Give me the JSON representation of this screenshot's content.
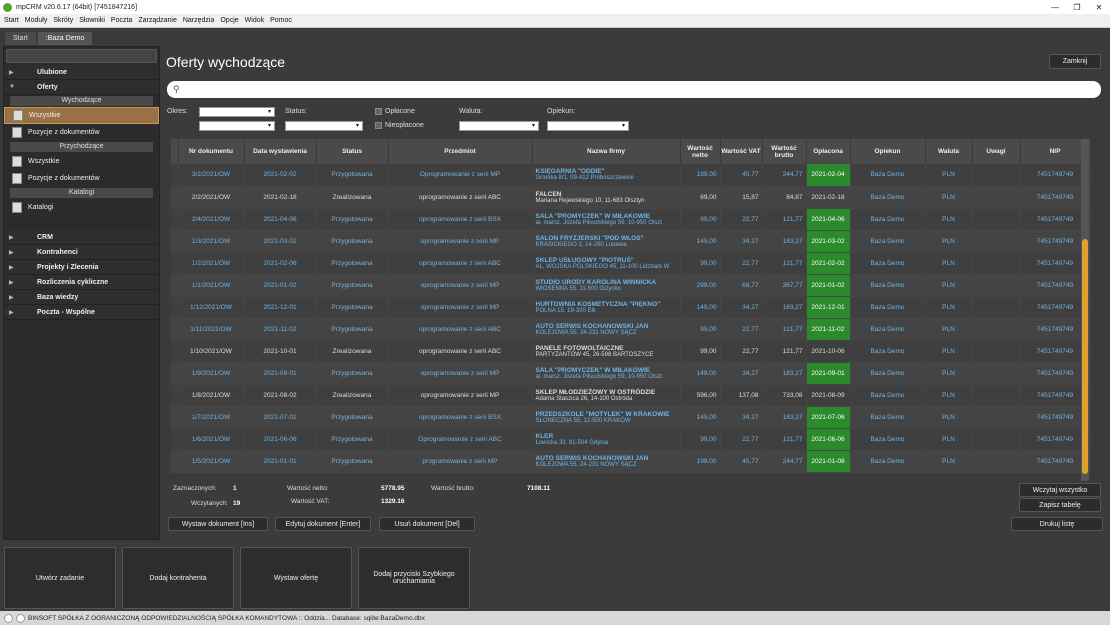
{
  "window": {
    "title": "mpCRM v20.6.17 (64bit) [7451847216]"
  },
  "menu": [
    "Start",
    "Moduły",
    "Skróty",
    "Słowniki",
    "Poczta",
    "Zarządzanie",
    "Narzędzia",
    "Opcje",
    "Widok",
    "Pomoc"
  ],
  "tabs": [
    "Start",
    ":Baza Demo"
  ],
  "sidebar": {
    "ulubione": "Ulubione",
    "oferty": "Oferty",
    "wychodzace": "Wychodzące",
    "wszystkie": "Wszystkie",
    "pozycje": "Pozycje z dokumentów",
    "przychodzace": "Przychodzące",
    "wszystkie2": "Wszystkie",
    "pozycje2": "Pozycje z dokumentów",
    "katalogi_hdr": "Katalogi",
    "katalogi": "Katalogi",
    "crm": "CRM",
    "kontrahenci": "Kontrahenci",
    "projekty": "Projekty i Zlecenia",
    "rozliczenia": "Rozliczenia cykliczne",
    "baza": "Baza wiedzy",
    "poczta": "Poczta - Wspólne"
  },
  "main": {
    "title": "Oferty wychodzące",
    "close": "Zamknij",
    "filters": {
      "okres": "Okres:",
      "status": "Status:",
      "oplacone": "Opłacone",
      "nieoplacone": "Nieopłacone",
      "waluta": "Waluta:",
      "opiekun": "Opiekun:"
    }
  },
  "table": {
    "headers": [
      "Nr dokumentu",
      "Data wystawienia",
      "Status",
      "Przedmiot",
      "Nazwa firmy",
      "Wartość netto",
      "Wartość VAT",
      "Wartość brutto",
      "Opłacona",
      "Opiekun",
      "Waluta",
      "Uwagi",
      "NIP"
    ],
    "rows": [
      {
        "nr": "3/2/2021/OW",
        "data": "2021-02-02",
        "status": "Przygotowana",
        "przedmiot": "Oprogramowanie z serii MP",
        "firma": "KSIĘGARNIA \"ODDIE\"",
        "adres": "Gromka 8/1, 09-412 Proboszczewice",
        "netto": "199,00",
        "vat": "45,77",
        "brutto": "244,77",
        "oplacona": "2021-02-04",
        "paid": true,
        "opiekun": "Baza Demo",
        "waluta": "PLN",
        "uwagi": "",
        "nip": "7451749749",
        "blue": true
      },
      {
        "nr": "2/2/2021/OW",
        "data": "2021-02-18",
        "status": "Zrealizowana",
        "przedmiot": "oprogramowanie z serii ABC",
        "firma": "FALCEN",
        "adres": "Mariana Rejewskiego 10, 11-683 Olsztyn",
        "netto": "69,00",
        "vat": "15,87",
        "brutto": "84,87",
        "oplacona": "2021-02-18",
        "paid": false,
        "opiekun": "Baza Demo",
        "waluta": "PLN",
        "uwagi": "",
        "nip": "7451749749",
        "blue": false
      },
      {
        "nr": "2/4/2021/OW",
        "data": "2021-04-06",
        "status": "Przygotowana",
        "przedmiot": "oprogramowanie z serii BSX",
        "firma": "SALA \"PROMYCZEK\" W MIŁAKOWIE",
        "adres": "al. marsz. Józefa Piłsudskiego 59, 10-950 Olszt",
        "netto": "99,00",
        "vat": "22,77",
        "brutto": "121,77",
        "oplacona": "2021-04-06",
        "paid": true,
        "opiekun": "Baza Demo",
        "waluta": "PLN",
        "uwagi": "",
        "nip": "7451749749",
        "blue": true
      },
      {
        "nr": "1/3/2021/OW",
        "data": "2021-03-02",
        "status": "Przygotowana",
        "przedmiot": "oprogramowanie z serii MP",
        "firma": "SALON FRYZJERSKI \"POD WŁOS\"",
        "adres": "KRASICKIEGO 2, 14-260 Lubawa",
        "netto": "149,00",
        "vat": "34,27",
        "brutto": "183,27",
        "oplacona": "2021-03-02",
        "paid": true,
        "opiekun": "Baza Demo",
        "waluta": "PLN",
        "uwagi": "",
        "nip": "7451749749",
        "blue": true
      },
      {
        "nr": "1/2/2021/OW",
        "data": "2021-02-06",
        "status": "Przygotowana",
        "przedmiot": "oprogramowanie z serii ABC",
        "firma": "SKLEP USŁUGOWY \"PIOTRUŚ\"",
        "adres": "AL. WOJSKA POLSKIEGO 45, 11-100 Lidzbark W",
        "netto": "99,00",
        "vat": "22,77",
        "brutto": "121,77",
        "oplacona": "2021-02-02",
        "paid": true,
        "opiekun": "Baza Demo",
        "waluta": "PLN",
        "uwagi": "",
        "nip": "7451749749",
        "blue": true
      },
      {
        "nr": "1/1/2021/OW",
        "data": "2021-01-02",
        "status": "Przygotowana",
        "przedmiot": "oprogramowanie z serii MP",
        "firma": "STUDIO URODY KAROLINA WINNICKA",
        "adres": "WIOSENNA 55, 11-500 Giżycko",
        "netto": "299,00",
        "vat": "68,77",
        "brutto": "367,77",
        "oplacona": "2021-01-02",
        "paid": true,
        "opiekun": "Baza Demo",
        "waluta": "PLN",
        "uwagi": "",
        "nip": "7451749749",
        "blue": true
      },
      {
        "nr": "1/12/2021/OW",
        "data": "2021-12-01",
        "status": "Przygotowana",
        "przedmiot": "oprogramowanie z serii MP",
        "firma": "HURTOWNIA KOSMETYCZNA \"PIĘKNO\"",
        "adres": "POLNA 15, 19-300 Ełk",
        "netto": "149,00",
        "vat": "34,27",
        "brutto": "183,27",
        "oplacona": "2021-12-01",
        "paid": true,
        "opiekun": "Baza Demo",
        "waluta": "PLN",
        "uwagi": "",
        "nip": "7451749749",
        "blue": true
      },
      {
        "nr": "1/11/2021/OW",
        "data": "2021-11-02",
        "status": "Przygotowana",
        "przedmiot": "oprogramowanie z serii ABC",
        "firma": "AUTO SERWIS KOCHANOWSKI JAN",
        "adres": "KOLEJOWA 55, 24-231 NOWY SĄCZ",
        "netto": "99,00",
        "vat": "22,77",
        "brutto": "121,77",
        "oplacona": "2021-11-02",
        "paid": true,
        "opiekun": "Baza Demo",
        "waluta": "PLN",
        "uwagi": "",
        "nip": "7451749749",
        "blue": true
      },
      {
        "nr": "1/10/2021/OW",
        "data": "2021-10-01",
        "status": "Zrealizowana",
        "przedmiot": "oprogramowanie z serii ABC",
        "firma": "PANELE FOTOWOLTAICZNE",
        "adres": "PARTYZANTÓW 45, 26-598 BARTOSZYCE",
        "netto": "99,00",
        "vat": "22,77",
        "brutto": "121,77",
        "oplacona": "2021-10-06",
        "paid": false,
        "opiekun": "Baza Demo",
        "waluta": "PLN",
        "uwagi": "",
        "nip": "7451749749",
        "blue": false
      },
      {
        "nr": "1/9/2021/OW",
        "data": "2021-09-01",
        "status": "Przygotowana",
        "przedmiot": "oprogramowanie z serii MP",
        "firma": "SALA \"PROMYCZEK\" W MIŁAKOWIE",
        "adres": "al. marsz. Józefa Piłsudskiego 59, 10-950 Olszt",
        "netto": "149,00",
        "vat": "34,27",
        "brutto": "183,27",
        "oplacona": "2021-09-01",
        "paid": true,
        "opiekun": "Baza Demo",
        "waluta": "PLN",
        "uwagi": "",
        "nip": "7451749749",
        "blue": true
      },
      {
        "nr": "1/8/2021/OW",
        "data": "2021-08-02",
        "status": "Zrealizowana",
        "przedmiot": "oprogramowanie z serii MP",
        "firma": "SKLEP MŁODZIEŻOWY W OSTRÓDZIE",
        "adres": "Adama Staszica 26, 14-100 Ostróda",
        "netto": "596,00",
        "vat": "137,08",
        "brutto": "733,08",
        "oplacona": "2021-08-09",
        "paid": false,
        "opiekun": "Baza Demo",
        "waluta": "PLN",
        "uwagi": "",
        "nip": "7451749749",
        "blue": false
      },
      {
        "nr": "1/7/2021/OW",
        "data": "2021-07-01",
        "status": "Przygotowana",
        "przedmiot": "oprogramowanie z serii BSX",
        "firma": "PRZEDSZKOLE \"MOTYLEK\" W KRAKOWIE",
        "adres": "SŁONECZNA 55, 12-500 KRAKÓW",
        "netto": "149,00",
        "vat": "34,27",
        "brutto": "183,27",
        "oplacona": "2021-07-06",
        "paid": true,
        "opiekun": "Baza Demo",
        "waluta": "PLN",
        "uwagi": "",
        "nip": "7451749749",
        "blue": true
      },
      {
        "nr": "1/6/2021/OW",
        "data": "2021-06-06",
        "status": "Przygotowana",
        "przedmiot": "Oprogramowanie z serii ABC",
        "firma": "KLER",
        "adres": "Łowicka 33, 81-504 Gdynia",
        "netto": "99,00",
        "vat": "22,77",
        "brutto": "121,77",
        "oplacona": "2021-06-06",
        "paid": true,
        "opiekun": "Baza Demo",
        "waluta": "PLN",
        "uwagi": "",
        "nip": "7451749749",
        "blue": true
      },
      {
        "nr": "1/5/2021/OW",
        "data": "2021-01-01",
        "status": "Przygotowana",
        "przedmiot": "programowanie z serii MP",
        "firma": "AUTO SERWIS KOCHANOWSKI JAN",
        "adres": "KOLEJOWA 55, 24-231 NOWY SĄCZ",
        "netto": "199,00",
        "vat": "45,77",
        "brutto": "244,77",
        "oplacona": "2021-01-08",
        "paid": true,
        "opiekun": "Baza Demo",
        "waluta": "PLN",
        "uwagi": "",
        "nip": "7451749749",
        "blue": true
      }
    ]
  },
  "summary": {
    "zaznaczonych_lbl": "Zaznaczonych:",
    "zaznaczonych": "1",
    "wczytanych_lbl": "Wczytanych:",
    "wczytanych": "19",
    "netto_lbl": "Wartość netto:",
    "netto": "5778.95",
    "vat_lbl": "Wartość VAT:",
    "vat": "1329.16",
    "brutto_lbl": "Wartość brutto:",
    "brutto": "7108.11"
  },
  "buttons": {
    "wystaw": "Wystaw dokument [Ins]",
    "edytuj": "Edytuj dokument [Enter]",
    "usun": "Usuń dokument [Del]",
    "wczytaj": "Wczytaj wszystko",
    "zapisz": "Zapisz tabelę",
    "drukuj": "Drukuj listę"
  },
  "quick": [
    "Utwórz zadanie",
    "Dodaj kontrahenta",
    "Wystaw ofertę",
    "Dodaj przyciski Szybkiego uruchamiania"
  ],
  "status": "BINSOFT SPÓŁKA Z OGRANICZONĄ ODPOWIEDZIALNOŚCIĄ SPÓŁKA KOMANDYTOWA :: Oddzia... Database: sqlite:BazaDemo.dbx"
}
